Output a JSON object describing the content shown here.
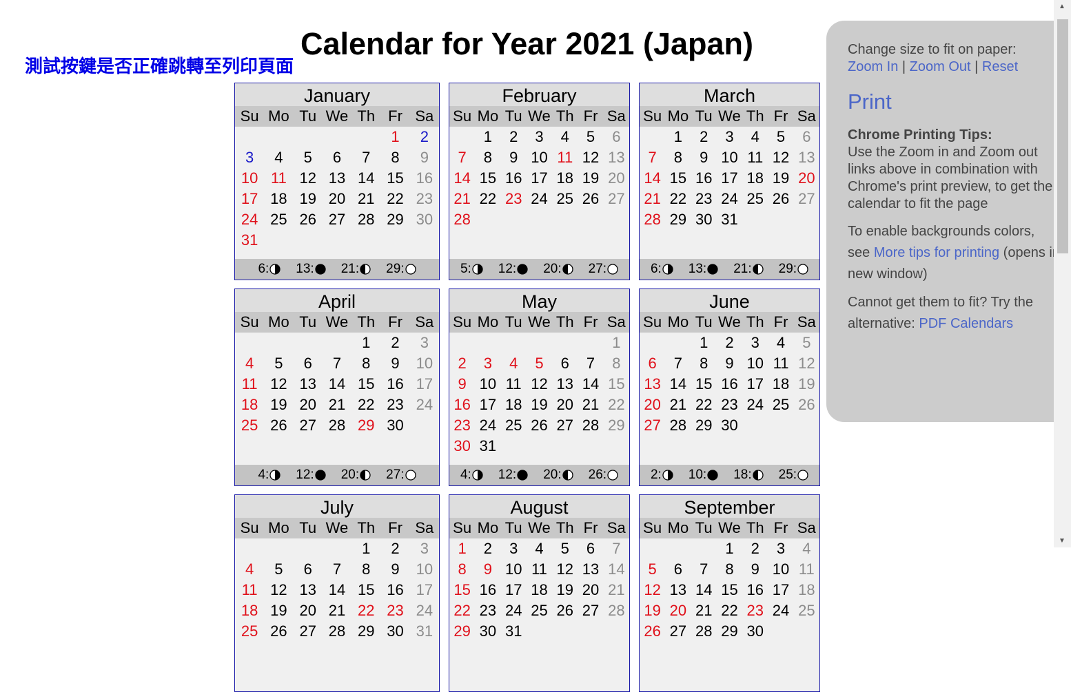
{
  "page": {
    "title": "Calendar for Year 2021 (Japan)",
    "test_link": "測試按鍵是否正確跳轉至列印頁面"
  },
  "weekdays": [
    "Su",
    "Mo",
    "Tu",
    "We",
    "Th",
    "Fr",
    "Sa"
  ],
  "months": [
    {
      "name": "January",
      "first_dow": 5,
      "days": 31,
      "red": [
        1,
        10,
        11,
        17,
        24,
        31
      ],
      "blue": [
        2,
        3
      ],
      "moons": [
        {
          "day": "6",
          "phase": "last-quarter"
        },
        {
          "day": "13",
          "phase": "new"
        },
        {
          "day": "21",
          "phase": "first-quarter"
        },
        {
          "day": "29",
          "phase": "full"
        }
      ]
    },
    {
      "name": "February",
      "first_dow": 1,
      "days": 28,
      "red": [
        7,
        11,
        14,
        21,
        23,
        28
      ],
      "blue": [],
      "moons": [
        {
          "day": "5",
          "phase": "last-quarter"
        },
        {
          "day": "12",
          "phase": "new"
        },
        {
          "day": "20",
          "phase": "first-quarter"
        },
        {
          "day": "27",
          "phase": "full"
        }
      ]
    },
    {
      "name": "March",
      "first_dow": 1,
      "days": 31,
      "red": [
        7,
        14,
        20,
        21,
        28
      ],
      "blue": [],
      "moons": [
        {
          "day": "6",
          "phase": "last-quarter"
        },
        {
          "day": "13",
          "phase": "new"
        },
        {
          "day": "21",
          "phase": "first-quarter"
        },
        {
          "day": "29",
          "phase": "full"
        }
      ]
    },
    {
      "name": "April",
      "first_dow": 4,
      "days": 30,
      "red": [
        4,
        11,
        18,
        25,
        29
      ],
      "blue": [],
      "moons": [
        {
          "day": "4",
          "phase": "last-quarter"
        },
        {
          "day": "12",
          "phase": "new"
        },
        {
          "day": "20",
          "phase": "first-quarter"
        },
        {
          "day": "27",
          "phase": "full"
        }
      ]
    },
    {
      "name": "May",
      "first_dow": 6,
      "days": 31,
      "red": [
        2,
        3,
        4,
        5,
        9,
        16,
        23,
        30
      ],
      "blue": [],
      "moons": [
        {
          "day": "4",
          "phase": "last-quarter"
        },
        {
          "day": "12",
          "phase": "new"
        },
        {
          "day": "20",
          "phase": "first-quarter"
        },
        {
          "day": "26",
          "phase": "full"
        }
      ]
    },
    {
      "name": "June",
      "first_dow": 2,
      "days": 30,
      "red": [
        6,
        13,
        20,
        27
      ],
      "blue": [],
      "moons": [
        {
          "day": "2",
          "phase": "last-quarter"
        },
        {
          "day": "10",
          "phase": "new"
        },
        {
          "day": "18",
          "phase": "first-quarter"
        },
        {
          "day": "25",
          "phase": "full"
        }
      ]
    },
    {
      "name": "July",
      "first_dow": 4,
      "days": 31,
      "red": [
        4,
        11,
        18,
        22,
        23,
        25
      ],
      "blue": [],
      "moons": []
    },
    {
      "name": "August",
      "first_dow": 0,
      "days": 31,
      "red": [
        1,
        8,
        9,
        15,
        22,
        29
      ],
      "blue": [],
      "moons": []
    },
    {
      "name": "September",
      "first_dow": 3,
      "days": 30,
      "red": [
        5,
        12,
        19,
        20,
        23,
        26
      ],
      "blue": [],
      "moons": []
    }
  ],
  "sidebar": {
    "fit_label": "Change size to fit on paper:",
    "zoom_in": "Zoom In",
    "sep1": " | ",
    "zoom_out": "Zoom Out",
    "sep2": " | ",
    "reset": "Reset",
    "print": "Print",
    "tips_title": "Chrome Printing Tips:",
    "tips_text": "Use the Zoom in and Zoom out links above in combination with Chrome's print preview, to get the calendar to fit the page",
    "bg_text_1": "To enable backgrounds colors, see ",
    "bg_link": "More tips for printing",
    "bg_text_2": " (opens in new window)",
    "alt_text": "Cannot get them to fit? Try the alternative: ",
    "alt_link": "PDF Calendars"
  },
  "colors": {
    "holiday": "#e0101a",
    "saturday_holiday": "#1a1ac8",
    "saturday": "#8c8c8c",
    "link": "#4b66c8",
    "test_link": "#0000e6"
  }
}
